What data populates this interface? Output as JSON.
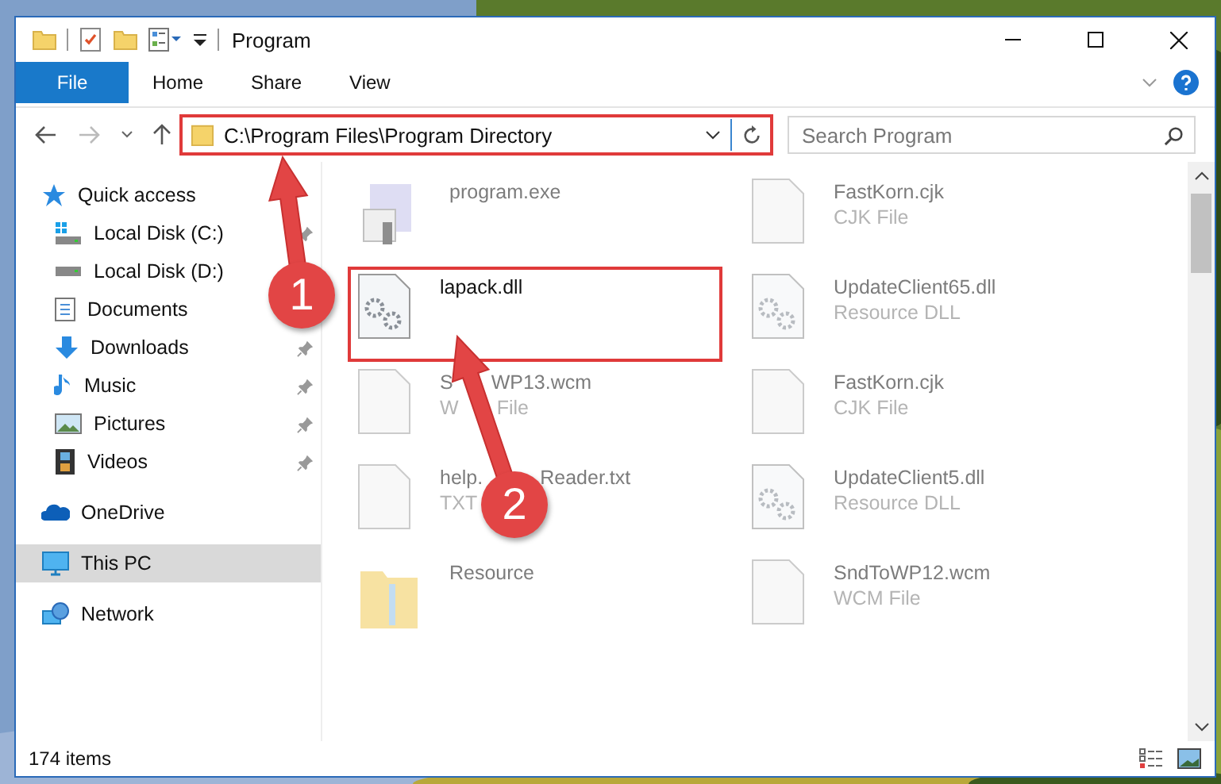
{
  "window": {
    "title": "Program"
  },
  "ribbon": {
    "tabs": [
      {
        "label": "File",
        "selected": true
      },
      {
        "label": "Home",
        "selected": false
      },
      {
        "label": "Share",
        "selected": false
      },
      {
        "label": "View",
        "selected": false
      }
    ]
  },
  "address_bar": {
    "path": "C:\\Program Files\\Program Directory",
    "highlighted": true
  },
  "search": {
    "placeholder": "Search Program"
  },
  "sidebar": {
    "items": [
      {
        "label": "Quick access",
        "kind": "star",
        "selected": false,
        "children": [
          {
            "label": "Local Disk (C:)",
            "kind": "windows-drive",
            "pinned": true,
            "selected": false
          },
          {
            "label": "Local Disk (D:)",
            "kind": "drive",
            "selected": false
          },
          {
            "label": "Documents",
            "kind": "documents",
            "selected": false
          },
          {
            "label": "Downloads",
            "kind": "downloads",
            "pinned": true,
            "selected": false
          },
          {
            "label": "Music",
            "kind": "music",
            "pinned": true,
            "selected": false
          },
          {
            "label": "Pictures",
            "kind": "pictures",
            "pinned": true,
            "selected": false
          },
          {
            "label": "Videos",
            "kind": "videos",
            "pinned": true,
            "selected": false
          }
        ]
      },
      {
        "label": "OneDrive",
        "kind": "cloud",
        "selected": false
      },
      {
        "label": "This PC",
        "kind": "pc",
        "selected": true
      },
      {
        "label": "Network",
        "kind": "network",
        "selected": false
      }
    ]
  },
  "files": [
    {
      "name": "program.exe",
      "kind": "exe",
      "blurred": true,
      "highlighted": false
    },
    {
      "name": "FastKorn.cjk",
      "type": "CJK File",
      "kind": "file",
      "blurred": true,
      "highlighted": false
    },
    {
      "name": "lapack.dll",
      "kind": "dll",
      "blurred": false,
      "highlighted": true
    },
    {
      "name": "UpdateClient65.dll",
      "type": "Resource DLL",
      "kind": "dll",
      "blurred": true,
      "highlighted": false
    },
    {
      "name_parts": [
        "S",
        "WP13.wcm"
      ],
      "type_parts": [
        "W",
        "File"
      ],
      "kind": "file",
      "blurred": true,
      "highlighted": false
    },
    {
      "name": "FastKorn.cjk",
      "type": "CJK File",
      "kind": "file",
      "blurred": true,
      "highlighted": false
    },
    {
      "name_parts": [
        "help.",
        "Reader.txt"
      ],
      "type_parts": [
        "TXT"
      ],
      "kind": "file",
      "blurred": true,
      "highlighted": false
    },
    {
      "name": "UpdateClient5.dll",
      "type": "Resource DLL",
      "kind": "dll",
      "blurred": true,
      "highlighted": false
    },
    {
      "name": "Resource",
      "kind": "folder",
      "blurred": true,
      "highlighted": false
    },
    {
      "name": "SndToWP12.wcm",
      "type": "WCM File",
      "kind": "file",
      "blurred": true,
      "highlighted": false
    }
  ],
  "status_bar": {
    "count": "174 items"
  },
  "annotations": [
    {
      "label": "1"
    },
    {
      "label": "2"
    }
  ]
}
